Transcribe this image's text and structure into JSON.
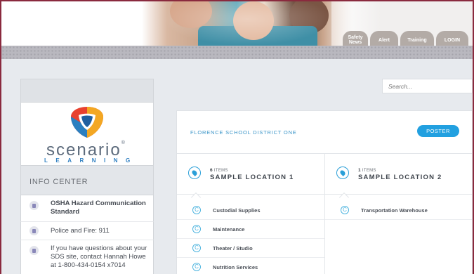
{
  "header": {
    "nav": [
      {
        "label": "Safety News"
      },
      {
        "label": "Alert"
      },
      {
        "label": "Training"
      },
      {
        "label": "LOGIN"
      }
    ]
  },
  "sidebar": {
    "logo": {
      "word": "scenario",
      "sub": "LEARNING"
    },
    "info_center_title": "INFO CENTER",
    "items": [
      {
        "text": "OSHA Hazard Communication Standard"
      },
      {
        "text": "Police and Fire: 911"
      },
      {
        "text": "If you have questions about your SDS site, contact Hannah Howe at 1-800-434-0154 x7014"
      }
    ]
  },
  "search": {
    "placeholder": "Search..."
  },
  "main": {
    "district": "FLORENCE SCHOOL DISTRICT ONE",
    "poster_button": "POSTER",
    "locations": [
      {
        "count": "6",
        "count_unit": "ITEMS",
        "name": "SAMPLE LOCATION 1",
        "items": [
          "Custodial Supplies",
          "Maintenance",
          "Theater / Studio",
          "Nutrition Services"
        ]
      },
      {
        "count": "1",
        "count_unit": "ITEMS",
        "name": "SAMPLE LOCATION 2",
        "items": [
          "Transportation Warehouse"
        ]
      }
    ]
  },
  "colors": {
    "accent": "#22a0e0",
    "frame": "#8a2a3e",
    "tab": "#b3aba6"
  }
}
